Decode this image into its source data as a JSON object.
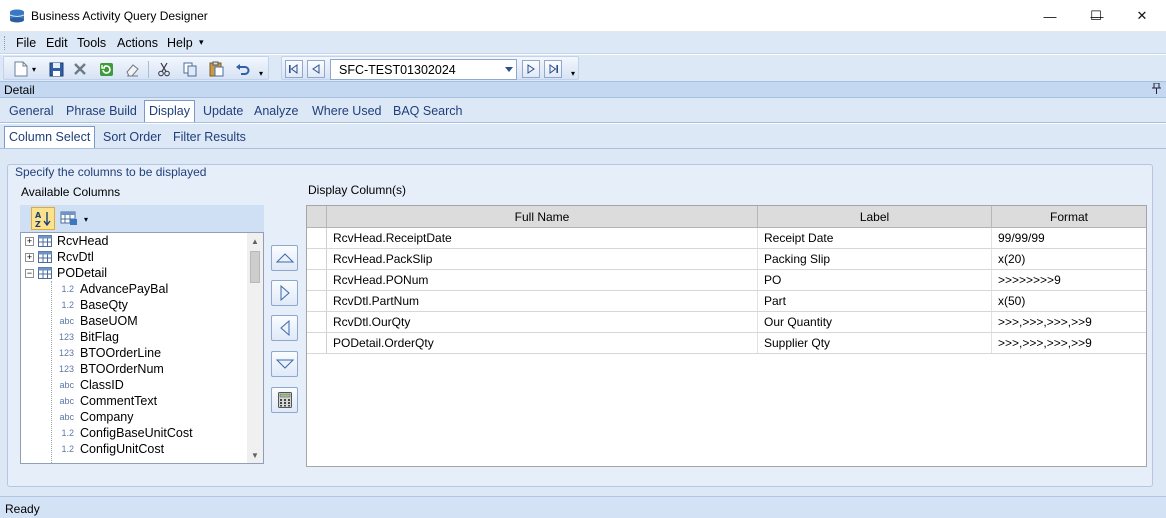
{
  "window": {
    "title": "Business Activity Query Designer",
    "minimize_glyph": "—",
    "maximize_glyph": "☐",
    "close_glyph": "✕"
  },
  "menu": {
    "items": [
      "File",
      "Edit",
      "Tools",
      "Actions",
      "Help"
    ],
    "overflow_glyph": "▾"
  },
  "toolbar": {
    "record_combo_value": "SFC-TEST01302024",
    "icons": [
      "new-icon",
      "save-icon",
      "delete-icon",
      "refresh-icon",
      "clear-icon",
      "cut-icon",
      "copy-icon",
      "paste-icon",
      "undo-icon"
    ],
    "nav_icons": [
      "first-record-icon",
      "previous-record-icon",
      "next-record-icon",
      "last-record-icon"
    ]
  },
  "detail": {
    "title": "Detail",
    "pin_glyph": "🖈"
  },
  "tabs": {
    "main": [
      "General",
      "Phrase Build",
      "Display",
      "Update",
      "Analyze",
      "Where Used",
      "BAQ Search"
    ],
    "main_active": "Display",
    "sub": [
      "Column Select",
      "Sort Order",
      "Filter Results"
    ],
    "sub_active": "Column Select"
  },
  "panel": {
    "caption": "Specify the columns to be displayed",
    "available_label": "Available Columns",
    "display_label": "Display Column(s)",
    "sort_glyph": "A↓Z"
  },
  "tree": {
    "tables": [
      {
        "name": "RcvHead",
        "expanded": false
      },
      {
        "name": "RcvDtl",
        "expanded": false
      },
      {
        "name": "PODetail",
        "expanded": true
      }
    ],
    "expand_glyph": "+",
    "collapse_glyph": "−",
    "fields": [
      {
        "type": "1.2",
        "name": "AdvancePayBal"
      },
      {
        "type": "1.2",
        "name": "BaseQty"
      },
      {
        "type": "abc",
        "name": "BaseUOM"
      },
      {
        "type": "123",
        "name": "BitFlag"
      },
      {
        "type": "123",
        "name": "BTOOrderLine"
      },
      {
        "type": "123",
        "name": "BTOOrderNum"
      },
      {
        "type": "abc",
        "name": "ClassID"
      },
      {
        "type": "abc",
        "name": "CommentText"
      },
      {
        "type": "abc",
        "name": "Company"
      },
      {
        "type": "1.2",
        "name": "ConfigBaseUnitCost"
      },
      {
        "type": "1.2",
        "name": "ConfigUnitCost"
      }
    ],
    "scroll_up_glyph": "▲",
    "scroll_down_glyph": "▼"
  },
  "grid": {
    "columns": [
      "Full Name",
      "Label",
      "Format"
    ],
    "rows": [
      {
        "full_name": "RcvHead.ReceiptDate",
        "label": "Receipt Date",
        "format": "99/99/99"
      },
      {
        "full_name": "RcvHead.PackSlip",
        "label": "Packing Slip",
        "format": "x(20)"
      },
      {
        "full_name": "RcvHead.PONum",
        "label": "PO",
        "format": ">>>>>>>>9"
      },
      {
        "full_name": "RcvDtl.PartNum",
        "label": "Part",
        "format": "x(50)"
      },
      {
        "full_name": "RcvDtl.OurQty",
        "label": "Our Quantity",
        "format": ">>>,>>>,>>>,>>9"
      },
      {
        "full_name": "PODetail.OrderQty",
        "label": "Supplier Qty",
        "format": ">>>,>>>,>>>,>>9"
      }
    ]
  },
  "status": {
    "text": "Ready"
  },
  "colors": {
    "accent": "#1f3f7a",
    "band": "#dde8f7",
    "detail_header": "#c4d8f1"
  }
}
